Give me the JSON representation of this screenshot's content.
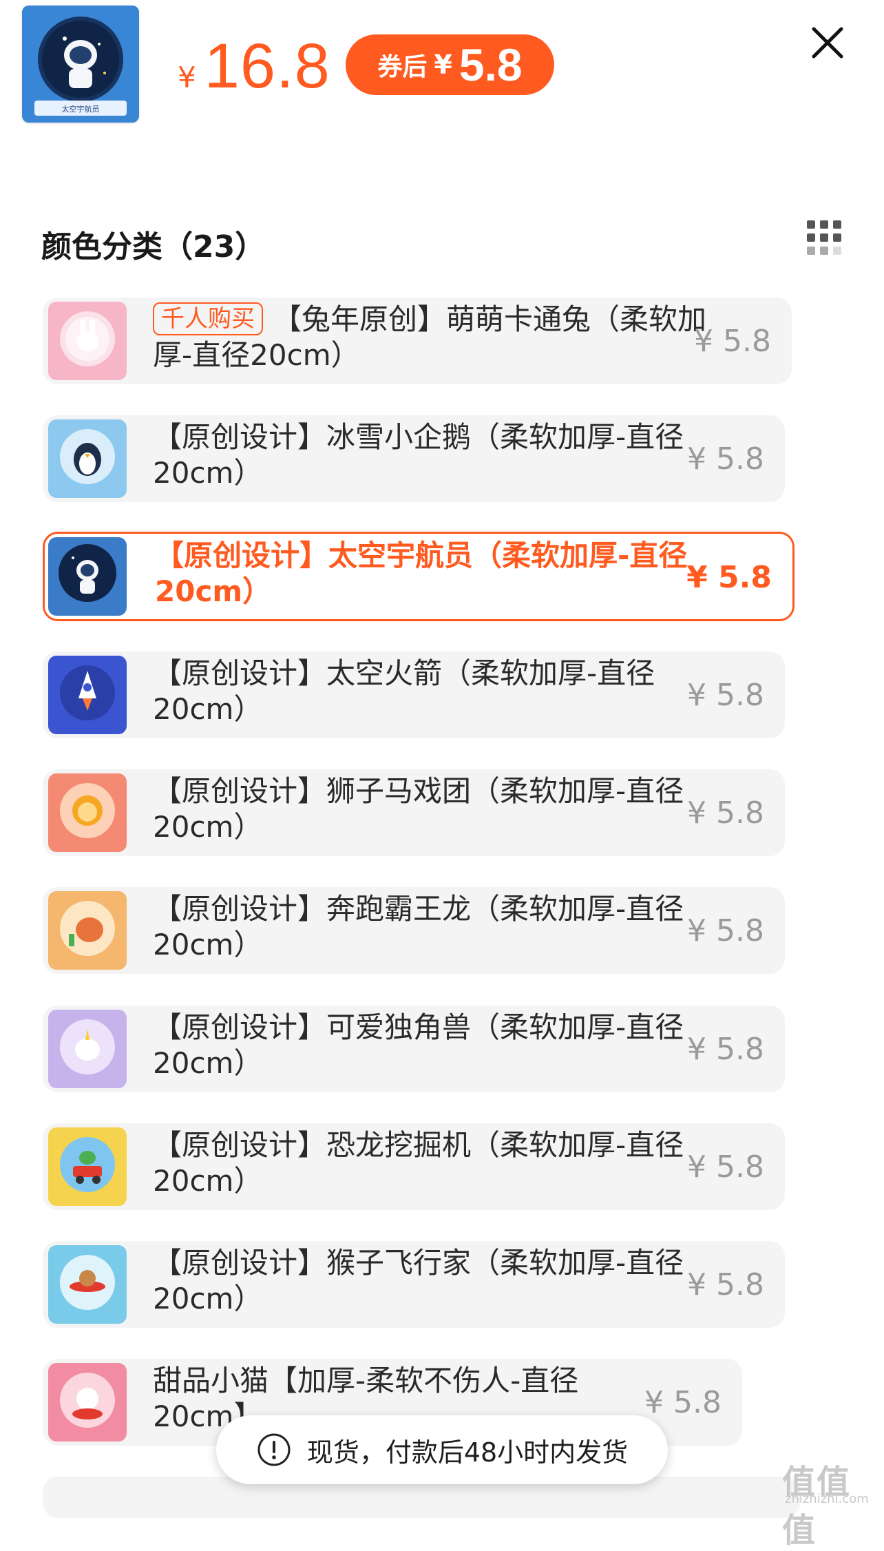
{
  "header": {
    "thumbnail_title": "太空宇航员",
    "price_symbol": "¥",
    "price": "16.8",
    "coupon_label": "券后",
    "coupon_symbol": "¥",
    "coupon_price": "5.8"
  },
  "section": {
    "title": "颜色分类（23）"
  },
  "items": [
    {
      "tag": "千人购买",
      "name": "【兔年原创】萌萌卡通兔（柔软加厚-直径20cm）",
      "price": "¥ 5.8",
      "selected": false,
      "thumb_color": "#f7b6c8"
    },
    {
      "tag": "",
      "name": "【原创设计】冰雪小企鹅（柔软加厚-直径20cm）",
      "price": "¥ 5.8",
      "selected": false,
      "thumb_color": "#8dc9ef"
    },
    {
      "tag": "",
      "name": "【原创设计】太空宇航员（柔软加厚-直径20cm）",
      "price": "¥ 5.8",
      "selected": true,
      "thumb_color": "#3b7cc9"
    },
    {
      "tag": "",
      "name": "【原创设计】太空火箭（柔软加厚-直径20cm）",
      "price": "¥ 5.8",
      "selected": false,
      "thumb_color": "#3b55d1"
    },
    {
      "tag": "",
      "name": "【原创设计】狮子马戏团（柔软加厚-直径20cm）",
      "price": "¥ 5.8",
      "selected": false,
      "thumb_color": "#f58a74"
    },
    {
      "tag": "",
      "name": "【原创设计】奔跑霸王龙（柔软加厚-直径20cm）",
      "price": "¥ 5.8",
      "selected": false,
      "thumb_color": "#f5b66e"
    },
    {
      "tag": "",
      "name": "【原创设计】可爱独角兽（柔软加厚-直径20cm）",
      "price": "¥ 5.8",
      "selected": false,
      "thumb_color": "#c7b3ec"
    },
    {
      "tag": "",
      "name": "【原创设计】恐龙挖掘机（柔软加厚-直径20cm）",
      "price": "¥ 5.8",
      "selected": false,
      "thumb_color": "#f6d34e"
    },
    {
      "tag": "",
      "name": "【原创设计】猴子飞行家（柔软加厚-直径20cm）",
      "price": "¥ 5.8",
      "selected": false,
      "thumb_color": "#79cbe9"
    },
    {
      "tag": "",
      "name": "甜品小猫【加厚-柔软不伤人-直径20cm】",
      "price": "¥ 5.8",
      "selected": false,
      "thumb_color": "#f18ca2"
    }
  ],
  "toast": {
    "icon": "exclamation-icon",
    "text": "现货，付款后48小时内发货"
  },
  "watermark": {
    "main": "值值值",
    "sub": "zhizhizhi.com"
  },
  "colors": {
    "accent": "#ff5a1f",
    "row_bg": "#f4f4f5",
    "muted_price": "#9a9a9a"
  }
}
